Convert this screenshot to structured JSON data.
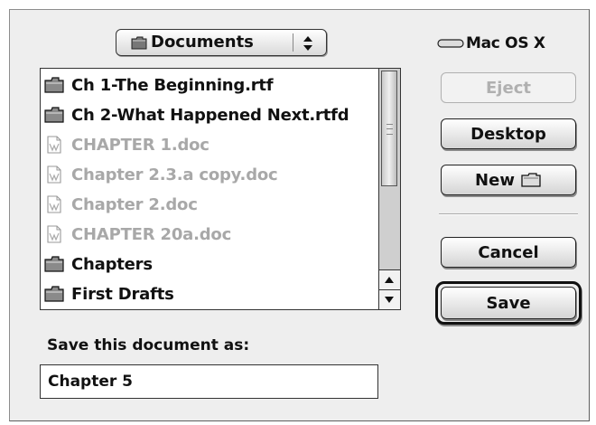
{
  "location_popup": {
    "label": "Documents"
  },
  "volume": {
    "label": "Mac OS X"
  },
  "file_list": {
    "items": [
      {
        "label": "Ch 1-The Beginning.rtf",
        "kind": "folder"
      },
      {
        "label": "Ch 2-What Happened Next.rtfd",
        "kind": "folder"
      },
      {
        "label": "CHAPTER 1.doc",
        "kind": "doc"
      },
      {
        "label": "Chapter 2.3.a copy.doc",
        "kind": "doc"
      },
      {
        "label": "Chapter 2.doc",
        "kind": "doc"
      },
      {
        "label": "CHAPTER 20a.doc",
        "kind": "doc"
      },
      {
        "label": "Chapters",
        "kind": "folder"
      },
      {
        "label": "First Drafts",
        "kind": "folder"
      }
    ]
  },
  "buttons": {
    "eject": "Eject",
    "desktop": "Desktop",
    "new": "New",
    "cancel": "Cancel",
    "save": "Save"
  },
  "save_prompt": "Save this document as:",
  "filename_value": "Chapter 5",
  "colors": {
    "dimmed_text": "#a8a8a8",
    "dialog_bg": "#eeeeee"
  }
}
